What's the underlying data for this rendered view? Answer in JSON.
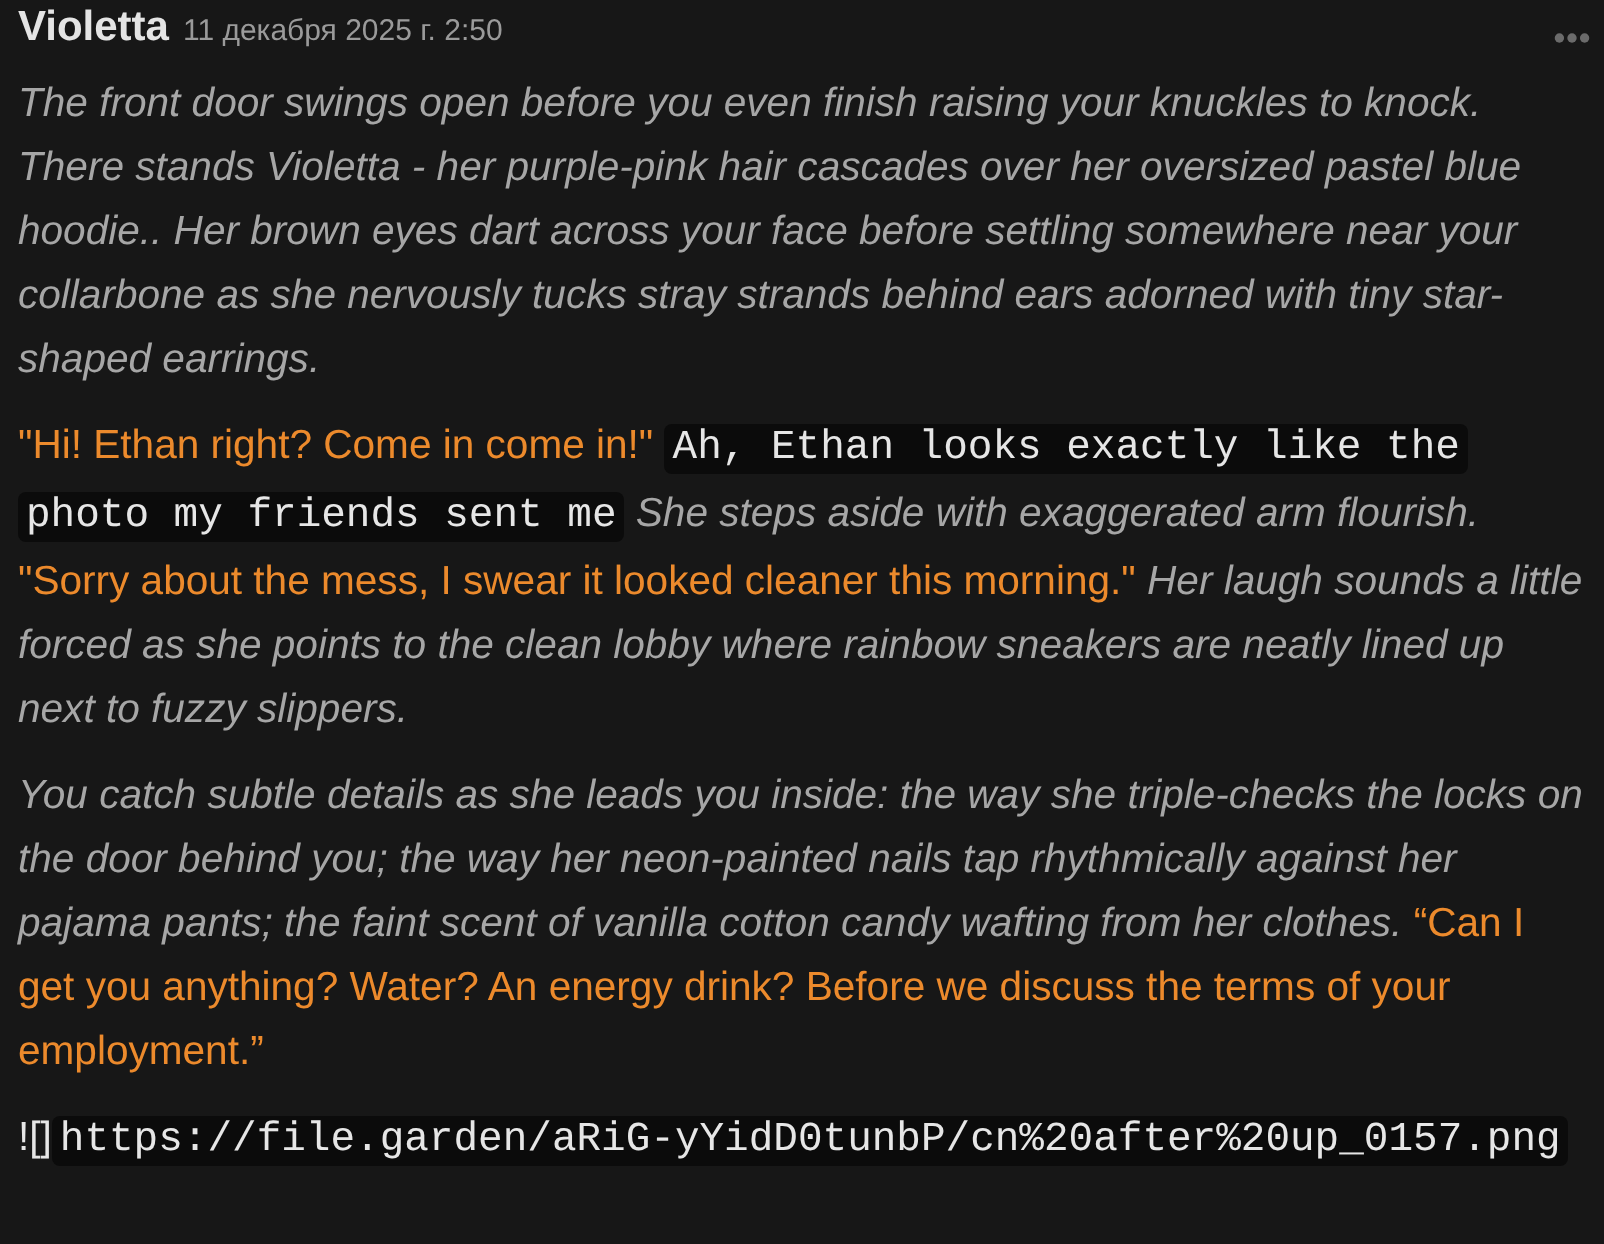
{
  "message": {
    "author": "Violetta",
    "timestamp": "11 декабря 2025 г. 2:50",
    "paragraphs": [
      [
        {
          "kind": "narration",
          "text": "The front door swings open before you even finish raising your knuckles to knock. There stands Violetta - her purple-pink hair cascades over her oversized pastel blue hoodie.. Her brown eyes dart across your face before settling somewhere near your collarbone as she nervously tucks stray strands behind ears adorned with tiny star-shaped earrings."
        }
      ],
      [
        {
          "kind": "quote",
          "text": "\"Hi! Ethan right? Come in come in!\""
        },
        {
          "kind": "code",
          "text": "Ah, Ethan looks exactly like the photo my friends sent me"
        },
        {
          "kind": "narration",
          "text": "She steps aside with exaggerated arm flourish."
        },
        {
          "kind": "quote",
          "text": "\"Sorry about the mess, I swear it looked cleaner this morning.\""
        },
        {
          "kind": "narration",
          "text": "Her laugh sounds a little forced as she points to the clean lobby where rainbow sneakers are neatly lined up next to fuzzy slippers."
        }
      ],
      [
        {
          "kind": "narration",
          "text": "You catch subtle details as she leads you inside: the way she triple-checks the locks on the door behind you; the way her neon-painted nails tap rhythmically against her pajama pants; the faint scent of vanilla cotton candy wafting from her clothes."
        },
        {
          "kind": "quote",
          "text": "“Can I get you anything? Water? An energy drink? Before we discuss the terms of your employment.”"
        }
      ],
      [
        {
          "kind": "plain",
          "text": "![]"
        },
        {
          "kind": "code",
          "text": "https://file.garden/aRiG-yYidD0tunbP/cn%20after%20up_0157.png"
        }
      ]
    ]
  }
}
